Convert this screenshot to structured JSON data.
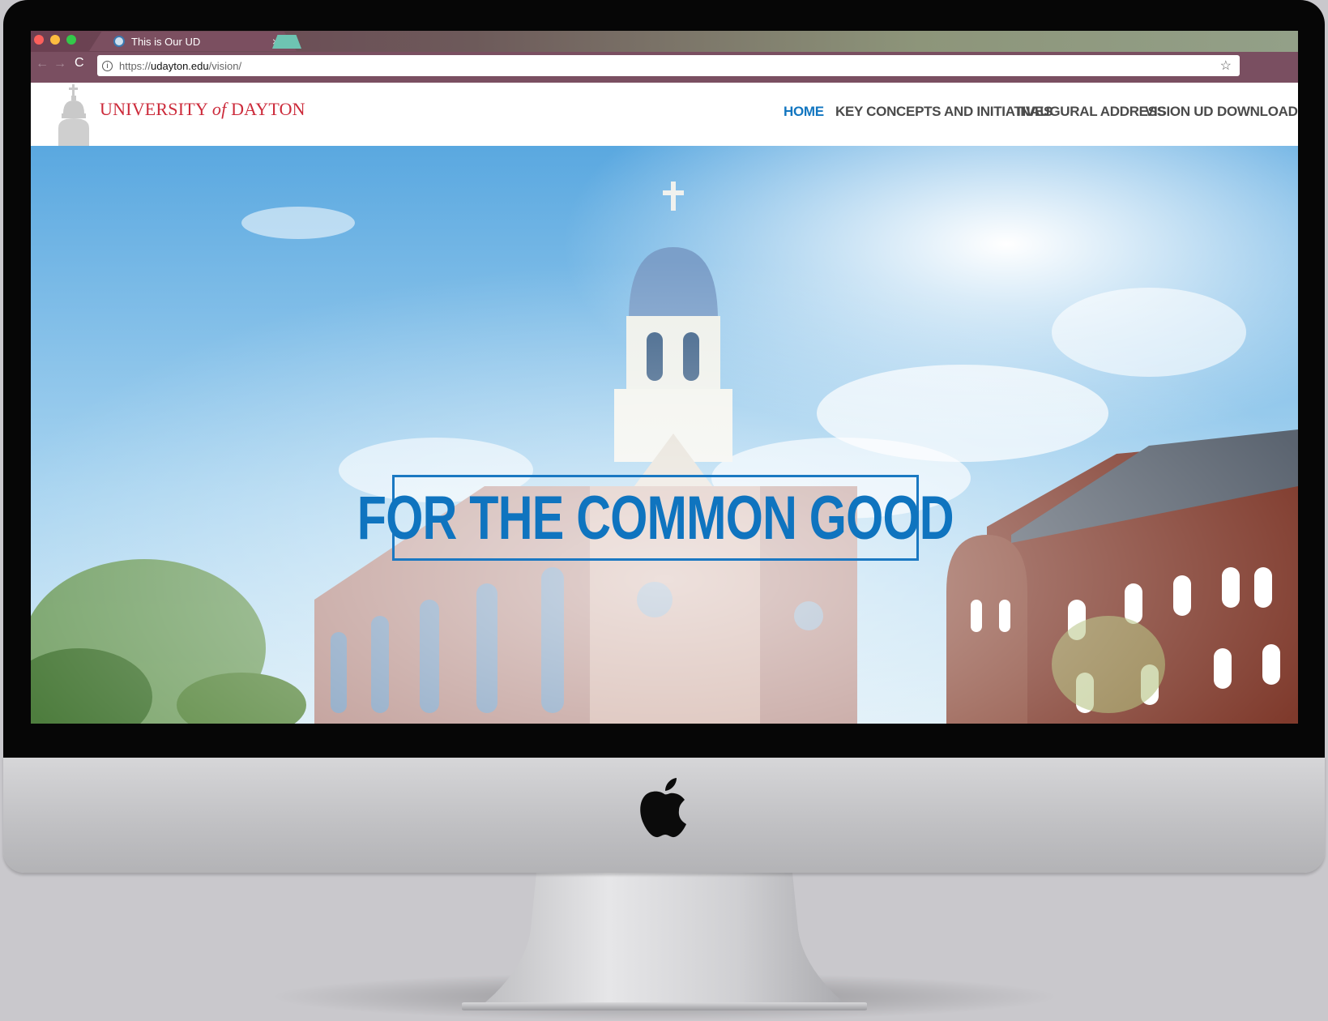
{
  "browser": {
    "tab_title": "This is Our UD",
    "tab_close": "×",
    "url_scheme": "https://",
    "url_host": "udayton.edu",
    "url_path": "/vision/",
    "info_glyph": "i",
    "star_glyph": "☆",
    "back_glyph": "←",
    "forward_glyph": "→",
    "reload_glyph": "C"
  },
  "site": {
    "logo_part1": "UNIVERSITY ",
    "logo_of": "of",
    "logo_part2": " DAYTON",
    "nav": [
      {
        "label": "HOME",
        "active": true
      },
      {
        "label": "KEY CONCEPTS AND INITIATIVES",
        "active": false
      },
      {
        "label": "INAUGURAL ADDRESS",
        "active": false
      },
      {
        "label": "VISION UD",
        "active": false
      },
      {
        "label": "DOWNLOADS",
        "active": false
      }
    ],
    "hero_title": "FOR THE COMMON GOOD"
  },
  "colors": {
    "accent": "#1276c0",
    "logo_red": "#cc2a3a",
    "nav_text": "#4a4a4a",
    "browser_chrome": "#7a4f61"
  },
  "icons": {
    "device_logo": "apple-logo-icon",
    "address_info": "info-icon",
    "bookmark": "star-icon"
  }
}
